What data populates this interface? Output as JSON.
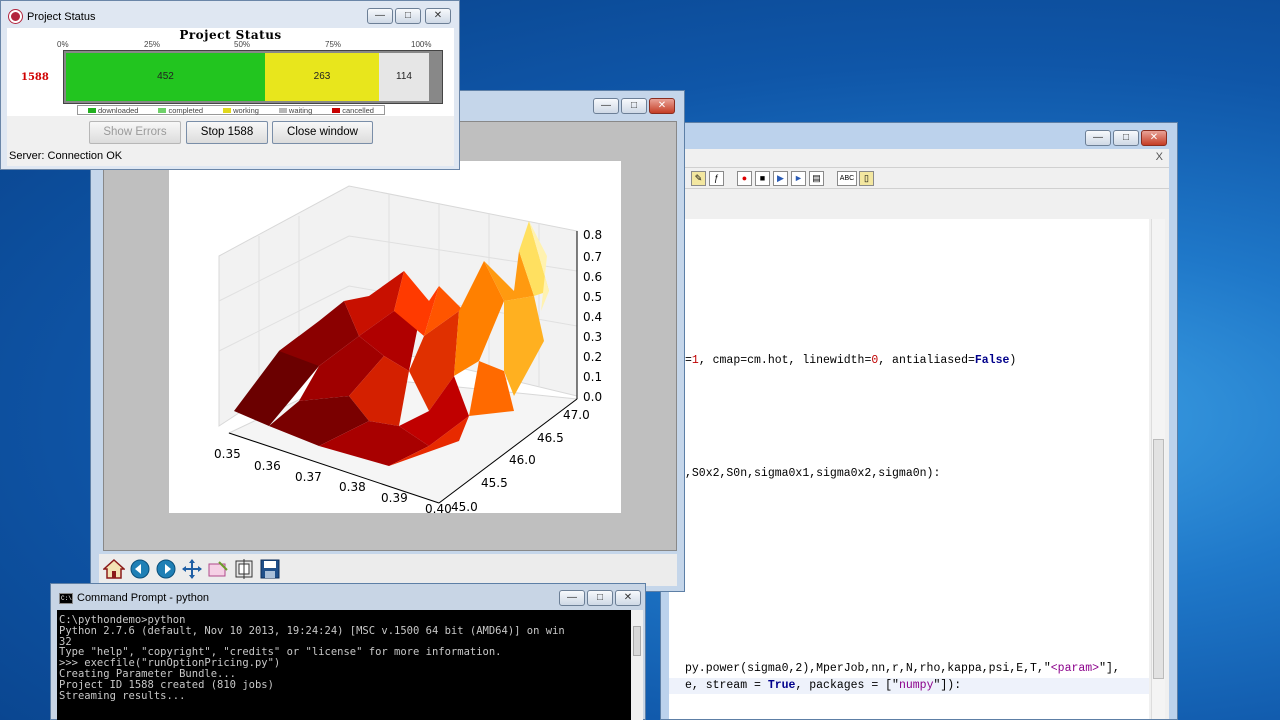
{
  "editor": {
    "tab_close": "X",
    "lines": [
      {
        "segments": [
          {
            "t": "=",
            "c": ""
          },
          {
            "t": "1",
            "c": "num"
          },
          {
            "t": ", cmap=cm.hot, linewidth=",
            "c": ""
          },
          {
            "t": "0",
            "c": "num"
          },
          {
            "t": ", antialiased=",
            "c": ""
          },
          {
            "t": "False",
            "c": "kw"
          },
          {
            "t": ")",
            "c": ""
          }
        ]
      },
      {
        "segments": [
          {
            "t": ",S0x2,S0n,sigma0x1,sigma0x2,sigma0n):",
            "c": ""
          }
        ]
      },
      {
        "segments": [
          {
            "t": "py.power(sigma0,2),MperJob,nn,r,N,rho,kappa,psi,E,T,\"",
            "c": ""
          },
          {
            "t": "<param>",
            "c": "str"
          },
          {
            "t": "\"],",
            "c": ""
          }
        ]
      },
      {
        "segments": [
          {
            "t": "e, stream = ",
            "c": ""
          },
          {
            "t": "True",
            "c": "kw"
          },
          {
            "t": ", packages = [\"",
            "c": ""
          },
          {
            "t": "numpy",
            "c": "str"
          },
          {
            "t": "\"]):",
            "c": ""
          }
        ]
      }
    ]
  },
  "plot": {
    "x_ticks": [
      "0.35",
      "0.36",
      "0.37",
      "0.38",
      "0.39",
      "0.40"
    ],
    "y_ticks": [
      "45.0",
      "45.5",
      "46.0",
      "46.5",
      "47.0"
    ],
    "z_ticks": [
      "0.0",
      "0.1",
      "0.2",
      "0.3",
      "0.4",
      "0.5",
      "0.6",
      "0.7",
      "0.8"
    ]
  },
  "status": {
    "title": "Project Status",
    "chart_title": "Project Status",
    "percent_labels": [
      "0%",
      "25%",
      "50%",
      "75%",
      "100%"
    ],
    "project_id": "1588",
    "segments": [
      {
        "label": "452",
        "fraction": 0.5294,
        "color": "#22c51f"
      },
      {
        "label": "263",
        "fraction": 0.3043,
        "color": "#e8e61c"
      },
      {
        "label": "114",
        "fraction": 0.1338,
        "color": "#e6e6e6"
      }
    ],
    "legend": [
      {
        "label": "downloaded",
        "color": "#22b020"
      },
      {
        "label": "completed",
        "color": "#6fd16a"
      },
      {
        "label": "working",
        "color": "#e0d81c"
      },
      {
        "label": "waiting",
        "color": "#b7b7b7"
      },
      {
        "label": "cancelled",
        "color": "#c80000"
      }
    ],
    "buttons": {
      "show_errors": "Show Errors",
      "stop": "Stop 1588",
      "close": "Close window"
    },
    "server": "Server: Connection OK"
  },
  "cmd": {
    "title": "Command Prompt - python",
    "lines": [
      "C:\\pythondemo>python",
      "Python 2.7.6 (default, Nov 10 2013, 19:24:24) [MSC v.1500 64 bit (AMD64)] on win",
      "32",
      "Type \"help\", \"copyright\", \"credits\" or \"license\" for more information.",
      ">>> execfile(\"runOptionPricing.py\")",
      "Creating Parameter Bundle...",
      "Project ID 1588 created (810 jobs)",
      "Streaming results..."
    ]
  }
}
